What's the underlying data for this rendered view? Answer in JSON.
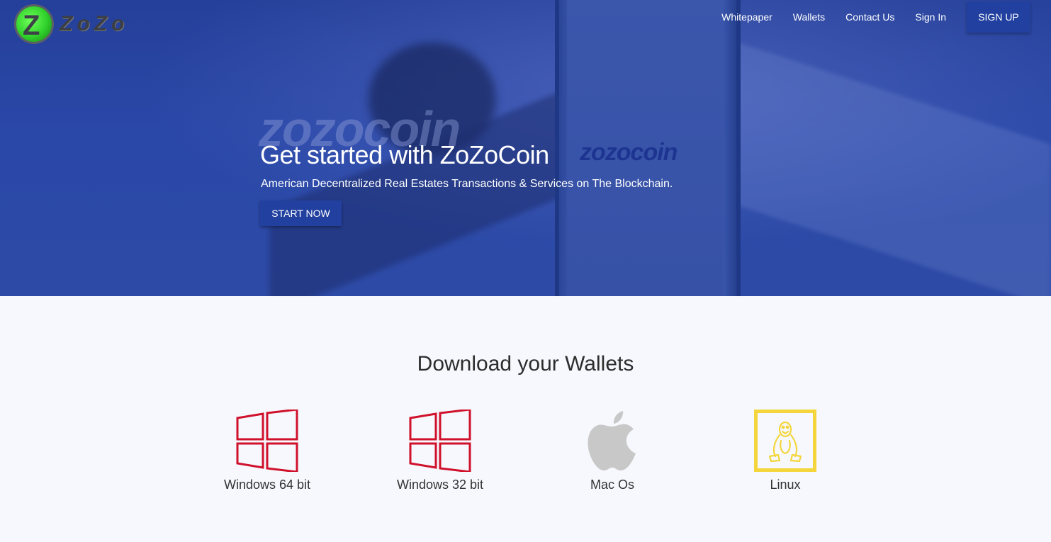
{
  "logo": {
    "letter": "Z",
    "text": "ZoZo"
  },
  "nav": {
    "items": [
      "Whitepaper",
      "Wallets",
      "Contact Us",
      "Sign In"
    ],
    "signup": "SIGN UP"
  },
  "hero": {
    "watermark": "zozocoin",
    "phone_logo": "zozocoin",
    "title": "Get started with ZoZoCoin",
    "subtitle": "American Decentralized Real Estates Transactions & Services on The Blockchain.",
    "cta": "START NOW"
  },
  "downloads": {
    "title": "Download your Wallets",
    "wallets": [
      {
        "label": "Windows 64 bit",
        "icon": "windows-icon",
        "color": "#d0112b"
      },
      {
        "label": "Windows 32 bit",
        "icon": "windows-icon",
        "color": "#d0112b"
      },
      {
        "label": "Mac Os",
        "icon": "apple-icon",
        "color": "#c8c8c8"
      },
      {
        "label": "Linux",
        "icon": "linux-tux-icon",
        "color": "#f4d63c"
      }
    ]
  }
}
